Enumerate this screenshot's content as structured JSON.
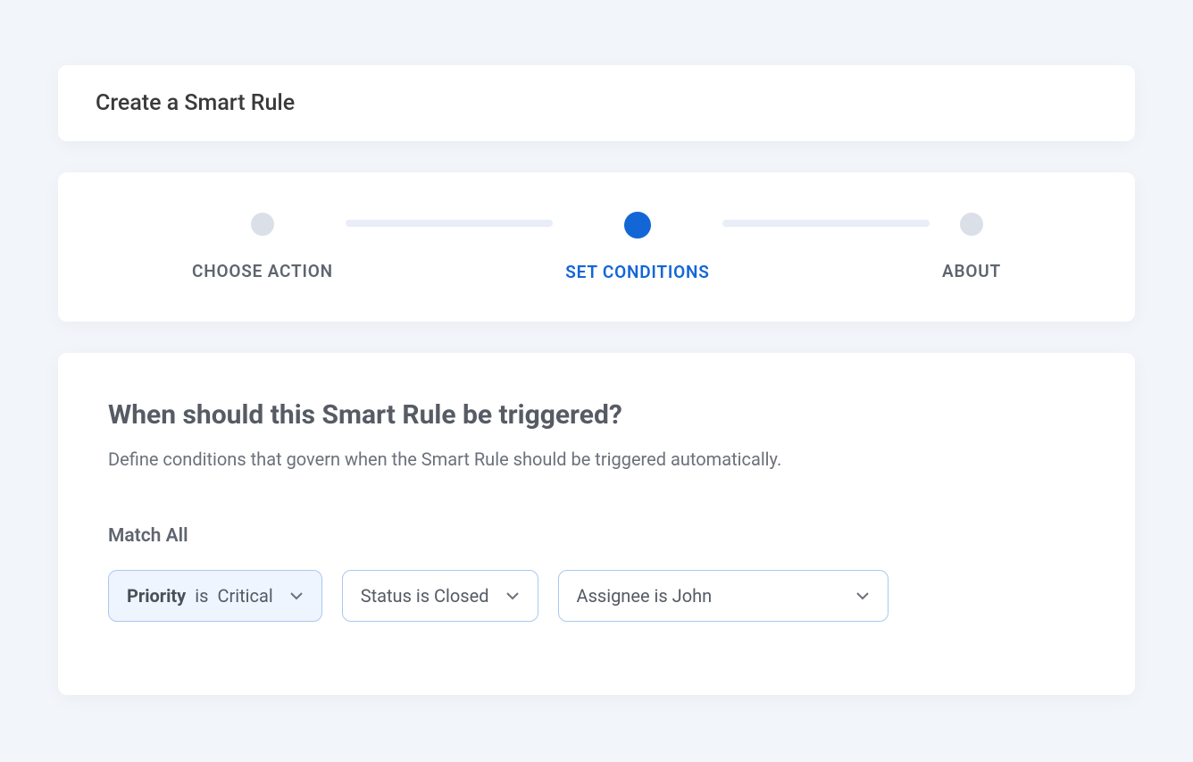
{
  "header": {
    "title": "Create a Smart Rule"
  },
  "stepper": {
    "steps": [
      {
        "label": "CHOOSE ACTION",
        "active": false
      },
      {
        "label": "SET CONDITIONS",
        "active": true
      },
      {
        "label": "ABOUT",
        "active": false
      }
    ]
  },
  "content": {
    "heading": "When should this Smart Rule be triggered?",
    "subheading": "Define conditions that govern when the Smart Rule should be triggered automatically.",
    "match_label": "Match All",
    "conditions": [
      {
        "key": "Priority",
        "is": "is",
        "value": "Critical"
      },
      {
        "text": "Status is Closed"
      },
      {
        "text": "Assignee is John"
      }
    ]
  }
}
